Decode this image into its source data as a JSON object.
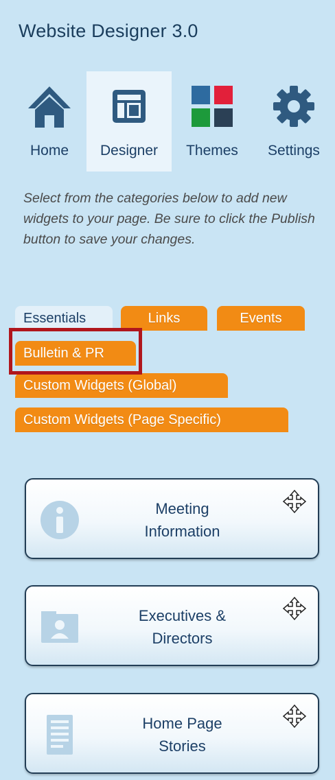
{
  "header": {
    "title": "Website Designer 3.0"
  },
  "nav": [
    {
      "label": "Home",
      "icon": "home-icon"
    },
    {
      "label": "Designer",
      "icon": "designer-icon"
    },
    {
      "label": "Themes",
      "icon": "themes-icon"
    },
    {
      "label": "Settings",
      "icon": "gear-icon"
    }
  ],
  "intro": "Select from the categories below to add new widgets to your page. Be sure to click the Publish button to save your changes.",
  "categories": [
    {
      "label": "Essentials",
      "selected": true
    },
    {
      "label": "Links",
      "selected": false
    },
    {
      "label": "Events",
      "selected": false
    },
    {
      "label": "Bulletin & PR",
      "selected": false,
      "highlighted": true
    },
    {
      "label": "Custom Widgets (Global)",
      "selected": false
    },
    {
      "label": "Custom Widgets (Page Specific)",
      "selected": false
    }
  ],
  "widgets": [
    {
      "title_line1": "Meeting",
      "title_line2": "Information",
      "icon": "info-icon",
      "move_icon": "move-icon"
    },
    {
      "title_line1": "Executives &",
      "title_line2": "Directors",
      "icon": "directory-icon",
      "move_icon": "move-icon"
    },
    {
      "title_line1": "Home Page",
      "title_line2": "Stories",
      "icon": "document-icon",
      "move_icon": "move-icon"
    }
  ],
  "colors": {
    "background": "#c9e4f4",
    "accent_orange": "#f28b14",
    "highlight_red": "#b0161c",
    "text_dark_blue": "#1c3f66"
  }
}
